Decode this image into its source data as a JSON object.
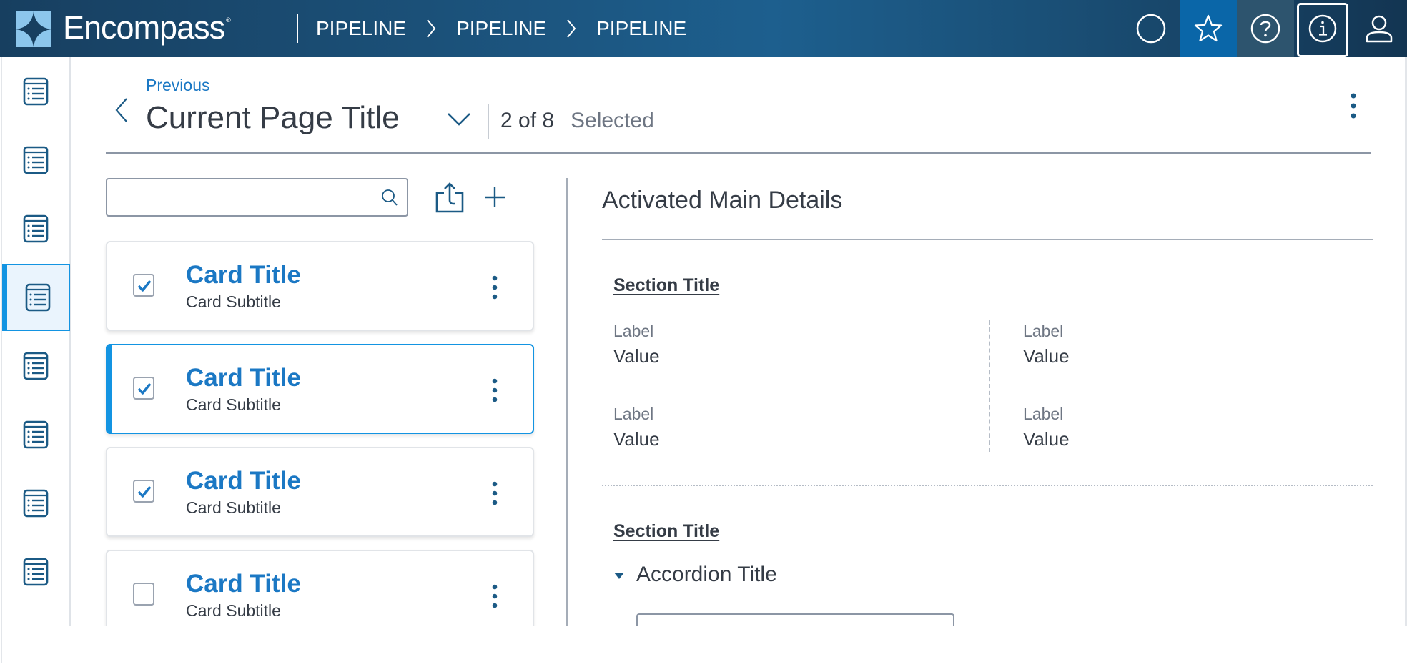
{
  "header": {
    "app_name": "Encompass",
    "registered_mark": "®",
    "breadcrumb": [
      "PIPELINE",
      "PIPELINE",
      "PIPELINE"
    ],
    "tools": [
      {
        "name": "circle-icon",
        "label": "Status"
      },
      {
        "name": "star-icon",
        "label": "Favorites",
        "active": true
      },
      {
        "name": "help-icon",
        "label": "Help"
      },
      {
        "name": "info-icon",
        "label": "Info",
        "focused": true
      },
      {
        "name": "user-icon",
        "label": "User profile"
      }
    ],
    "colors": {
      "brand": "#1d5f8e",
      "star_bg": "#0a66a8",
      "help_bg": "#2d546e"
    }
  },
  "sidebar": {
    "items": [
      {
        "icon": "list-icon",
        "active": false
      },
      {
        "icon": "list-icon",
        "active": false
      },
      {
        "icon": "list-icon",
        "active": false
      },
      {
        "icon": "list-icon",
        "active": true
      },
      {
        "icon": "list-icon",
        "active": false
      },
      {
        "icon": "list-icon",
        "active": false
      },
      {
        "icon": "list-icon",
        "active": false
      },
      {
        "icon": "list-icon",
        "active": false
      }
    ],
    "active_color": "#1394e2"
  },
  "page": {
    "previous_label": "Previous",
    "title": "Current Page Title",
    "selection_count": "2 of 8",
    "selection_label": "Selected"
  },
  "list": {
    "search": {
      "value": "",
      "placeholder": ""
    },
    "cards": [
      {
        "title": "Card Title",
        "subtitle": "Card Subtitle",
        "checked": true,
        "selected": false
      },
      {
        "title": "Card Title",
        "subtitle": "Card Subtitle",
        "checked": true,
        "selected": true
      },
      {
        "title": "Card Title",
        "subtitle": "Card Subtitle",
        "checked": true,
        "selected": false
      },
      {
        "title": "Card Title",
        "subtitle": "Card Subtitle",
        "checked": false,
        "selected": false
      }
    ]
  },
  "details": {
    "title": "Activated Main Details",
    "sections": [
      {
        "title": "Section Title",
        "fields": [
          {
            "label": "Label",
            "value": "Value"
          },
          {
            "label": "Label",
            "value": "Value"
          },
          {
            "label": "Label",
            "value": "Value"
          },
          {
            "label": "Label",
            "value": "Value"
          }
        ]
      },
      {
        "title": "Section Title",
        "accordion": {
          "title": "Accordion Title",
          "expanded": true
        }
      }
    ]
  }
}
